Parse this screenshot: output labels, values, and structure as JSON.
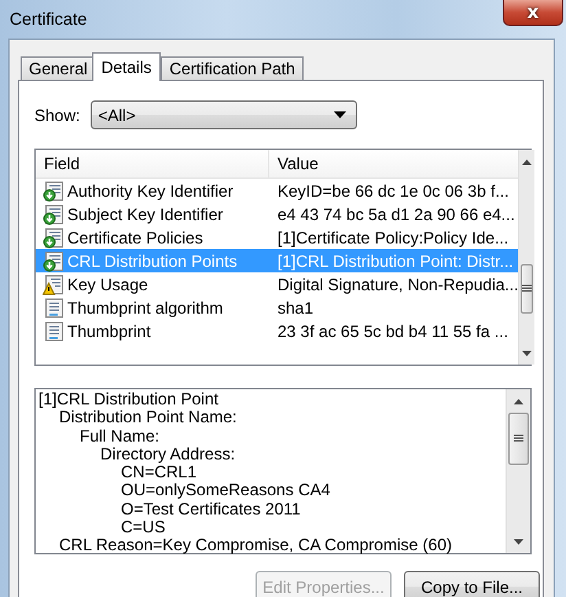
{
  "window": {
    "title": "Certificate",
    "close_label": "x"
  },
  "tabs": [
    {
      "label": "General",
      "selected": false
    },
    {
      "label": "Details",
      "selected": true
    },
    {
      "label": "Certification Path",
      "selected": false
    }
  ],
  "show": {
    "label": "Show:",
    "value": "<All>"
  },
  "table": {
    "columns": [
      "Field",
      "Value"
    ],
    "rows": [
      {
        "kind": "extension",
        "field": "Authority Key Identifier",
        "value": "KeyID=be 66 dc 1e 0c 06 3b f...",
        "selected": false
      },
      {
        "kind": "extension",
        "field": "Subject Key Identifier",
        "value": "e4 43 74 bc 5a d1 2a 90 66 e4...",
        "selected": false
      },
      {
        "kind": "extension",
        "field": "Certificate Policies",
        "value": "[1]Certificate Policy:Policy Ide...",
        "selected": false
      },
      {
        "kind": "extension",
        "field": "CRL Distribution Points",
        "value": "[1]CRL Distribution Point: Distr...",
        "selected": true
      },
      {
        "kind": "warning",
        "field": "Key Usage",
        "value": "Digital Signature, Non-Repudia...",
        "selected": false
      },
      {
        "kind": "property",
        "field": "Thumbprint algorithm",
        "value": "sha1",
        "selected": false
      },
      {
        "kind": "property",
        "field": "Thumbprint",
        "value": "23 3f ac 65 5c bd b4 11 55 fa ...",
        "selected": false
      }
    ]
  },
  "detail": [
    {
      "text": "[1]CRL Distribution Point",
      "children": [
        {
          "text": "Distribution Point Name:",
          "children": [
            {
              "text": "Full Name:",
              "children": [
                {
                  "text": "Directory Address:",
                  "children": [
                    {
                      "text": "CN=CRL1"
                    },
                    {
                      "text": "OU=onlySomeReasons CA4"
                    },
                    {
                      "text": "O=Test Certificates 2011"
                    },
                    {
                      "text": "C=US"
                    }
                  ]
                }
              ]
            }
          ]
        },
        {
          "text": "CRL Reason=Key Compromise, CA Compromise (60)"
        }
      ]
    }
  ],
  "buttons": [
    {
      "label": "Edit Properties...",
      "disabled": true
    },
    {
      "label": "Copy to File...",
      "disabled": false
    }
  ]
}
